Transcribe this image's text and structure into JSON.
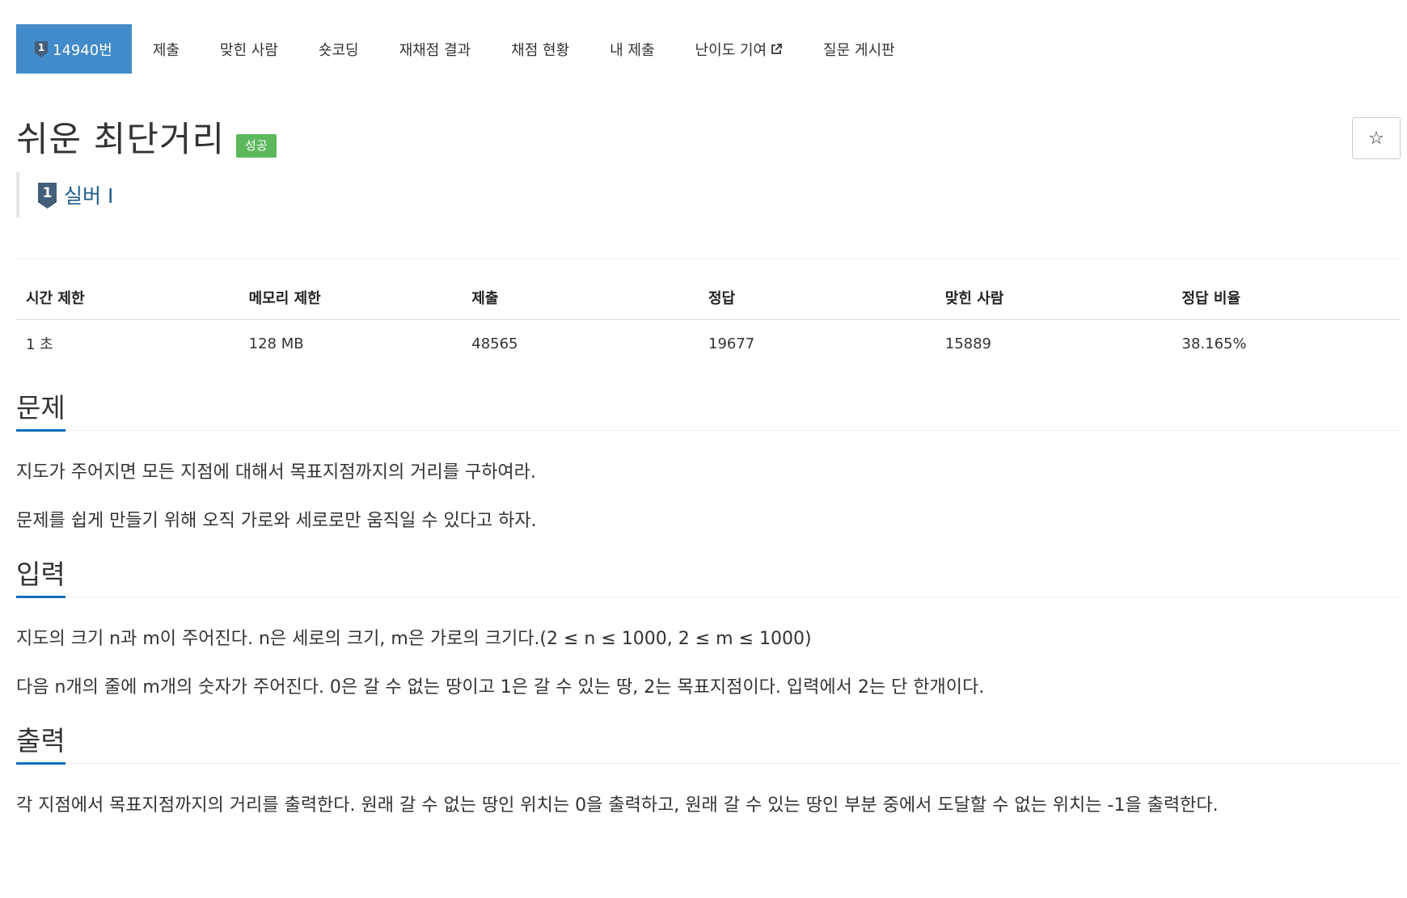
{
  "tabs": [
    {
      "label": "14940번",
      "active": true
    },
    {
      "label": "제출"
    },
    {
      "label": "맞힌 사람"
    },
    {
      "label": "숏코딩"
    },
    {
      "label": "재채점 결과"
    },
    {
      "label": "채점 현황"
    },
    {
      "label": "내 제출"
    },
    {
      "label": "난이도 기여"
    },
    {
      "label": "질문 게시판"
    }
  ],
  "tier_badge_number": "1",
  "title": "쉬운 최단거리",
  "result_label": "성공",
  "star_glyph": "☆",
  "tier_text": "실버 I",
  "info": {
    "headers": [
      "시간 제한",
      "메모리 제한",
      "제출",
      "정답",
      "맞힌 사람",
      "정답 비율"
    ],
    "values": [
      "1 초",
      "128 MB",
      "48565",
      "19677",
      "15889",
      "38.165%"
    ]
  },
  "sections": {
    "problem": {
      "heading": "문제",
      "paragraphs": [
        "지도가 주어지면 모든 지점에 대해서 목표지점까지의 거리를 구하여라.",
        "문제를 쉽게 만들기 위해 오직 가로와 세로로만 움직일 수 있다고 하자."
      ]
    },
    "input": {
      "heading": "입력",
      "paragraphs": [
        "지도의 크기 n과 m이 주어진다. n은 세로의 크기, m은 가로의 크기다.(2 ≤ n ≤ 1000, 2 ≤ m ≤ 1000)",
        "다음 n개의 줄에 m개의 숫자가 주어진다. 0은 갈 수 없는 땅이고 1은 갈 수 있는 땅, 2는 목표지점이다. 입력에서 2는 단 한개이다."
      ]
    },
    "output": {
      "heading": "출력",
      "paragraphs": [
        "각 지점에서 목표지점까지의 거리를 출력한다. 원래 갈 수 없는 땅인 위치는 0을 출력하고, 원래 갈 수 있는 땅인 부분 중에서 도달할 수 없는 위치는 -1을 출력한다."
      ]
    }
  },
  "colors": {
    "active_tab": "#428bca",
    "success_label": "#5cb85c",
    "tier_silver": "#435f7a",
    "section_underline": "#0e6ebd",
    "tier_text": "#1f5d8c"
  },
  "icons": {
    "tier": "silver-tier-badge-icon",
    "external_link": "external-link-icon",
    "star": "star-outline-icon"
  }
}
